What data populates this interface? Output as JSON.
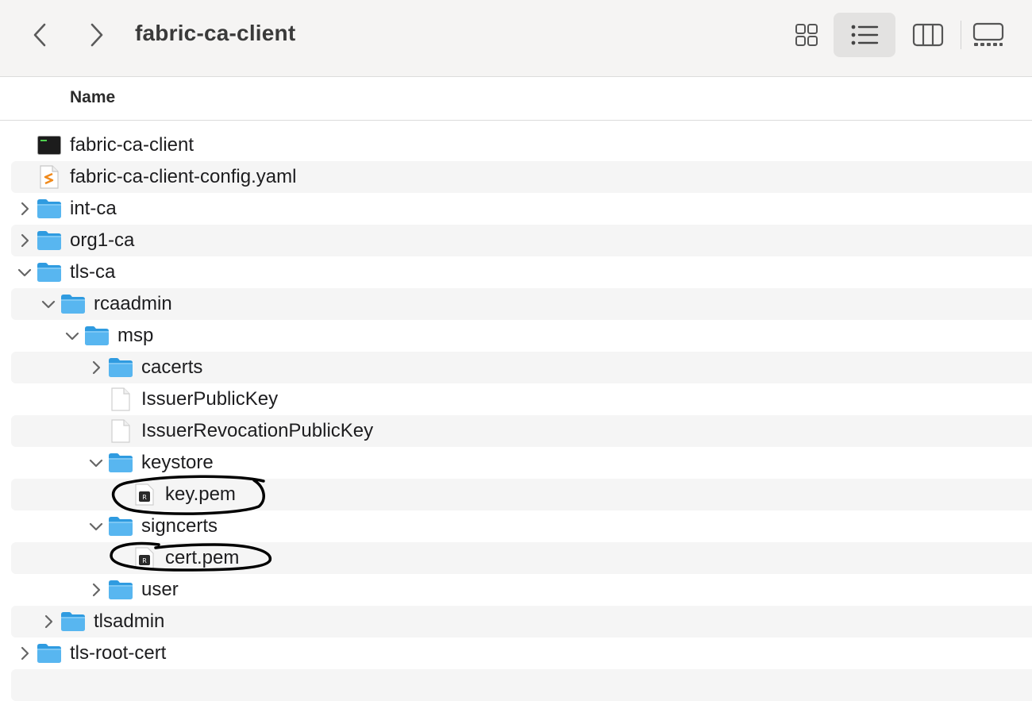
{
  "window": {
    "title": "fabric-ca-client",
    "back_icon": "chevron-left-icon",
    "forward_icon": "chevron-right-icon",
    "view_modes": [
      "icons-view-icon",
      "list-view-icon",
      "columns-view-icon",
      "gallery-view-icon"
    ],
    "active_view": "list"
  },
  "header": {
    "name_label": "Name"
  },
  "rows": [
    {
      "label": "fabric-ca-client",
      "kind": "exec",
      "depth": 0,
      "disclosure": "none"
    },
    {
      "label": "fabric-ca-client-config.yaml",
      "kind": "yaml",
      "depth": 0,
      "disclosure": "none"
    },
    {
      "label": "int-ca",
      "kind": "folder",
      "depth": 0,
      "disclosure": "collapsed"
    },
    {
      "label": "org1-ca",
      "kind": "folder",
      "depth": 0,
      "disclosure": "collapsed"
    },
    {
      "label": "tls-ca",
      "kind": "folder",
      "depth": 0,
      "disclosure": "expanded"
    },
    {
      "label": "rcaadmin",
      "kind": "folder",
      "depth": 1,
      "disclosure": "expanded"
    },
    {
      "label": "msp",
      "kind": "folder",
      "depth": 2,
      "disclosure": "expanded"
    },
    {
      "label": "cacerts",
      "kind": "folder",
      "depth": 3,
      "disclosure": "collapsed"
    },
    {
      "label": "IssuerPublicKey",
      "kind": "doc",
      "depth": 3,
      "disclosure": "none"
    },
    {
      "label": "IssuerRevocationPublicKey",
      "kind": "doc",
      "depth": 3,
      "disclosure": "none"
    },
    {
      "label": "keystore",
      "kind": "folder",
      "depth": 3,
      "disclosure": "expanded"
    },
    {
      "label": "key.pem",
      "kind": "pem",
      "depth": 4,
      "disclosure": "none"
    },
    {
      "label": "signcerts",
      "kind": "folder",
      "depth": 3,
      "disclosure": "expanded"
    },
    {
      "label": "cert.pem",
      "kind": "pem",
      "depth": 4,
      "disclosure": "none"
    },
    {
      "label": "user",
      "kind": "folder",
      "depth": 3,
      "disclosure": "collapsed"
    },
    {
      "label": "tlsadmin",
      "kind": "folder",
      "depth": 1,
      "disclosure": "collapsed"
    },
    {
      "label": "tls-root-cert",
      "kind": "folder",
      "depth": 0,
      "disclosure": "collapsed"
    }
  ],
  "annotations": [
    {
      "target": "key.pem",
      "kind": "hand-drawn-circle"
    },
    {
      "target": "cert.pem",
      "kind": "hand-drawn-circle"
    }
  ]
}
